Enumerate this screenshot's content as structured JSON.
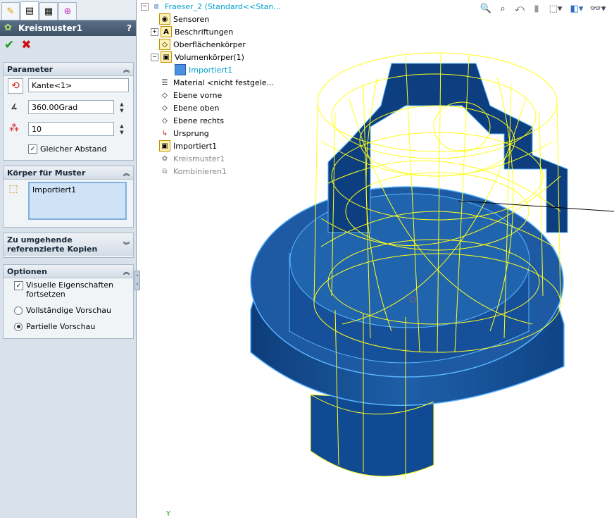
{
  "pm": {
    "tabs": [
      {
        "icon": "feature-manager-icon",
        "active": false
      },
      {
        "icon": "property-manager-icon",
        "active": true
      },
      {
        "icon": "configuration-manager-icon",
        "active": false
      },
      {
        "icon": "dimxpert-icon",
        "active": false
      }
    ],
    "title": "Kreismuster1",
    "help": "?",
    "parameter": {
      "header": "Parameter",
      "edge_value": "Kante<1>",
      "angle_value": "360.00Grad",
      "count_value": "10",
      "equal_spacing_label": "Gleicher Abstand"
    },
    "bodies": {
      "header": "Körper für Muster",
      "item": "Importiert1"
    },
    "skip": {
      "header": "Zu umgehende referenzierte Kopien"
    },
    "options": {
      "header": "Optionen",
      "visual_props": "Visuelle Eigenschaften fortsetzen",
      "full_preview": "Vollständige Vorschau",
      "partial_preview": "Partielle Vorschau"
    }
  },
  "tree": {
    "root": "Fraeser_2  (Standard<<Stan...",
    "items": [
      {
        "label": "Sensoren",
        "icon": "sensor-icon"
      },
      {
        "label": "Beschriftungen",
        "icon": "annotation-icon"
      },
      {
        "label": "Oberflächenkörper",
        "icon": "surface-body-icon"
      },
      {
        "label": "Volumenkörper(1)",
        "icon": "solid-body-icon"
      },
      {
        "label": "Importiert1",
        "icon": "body-icon"
      },
      {
        "label": "Material <nicht festgele...",
        "icon": "material-icon"
      },
      {
        "label": "Ebene vorne",
        "icon": "plane-icon"
      },
      {
        "label": "Ebene oben",
        "icon": "plane-icon"
      },
      {
        "label": "Ebene rechts",
        "icon": "plane-icon"
      },
      {
        "label": "Ursprung",
        "icon": "origin-icon"
      },
      {
        "label": "Importiert1",
        "icon": "imported-feature-icon"
      },
      {
        "label": "Kreismuster1",
        "icon": "circular-pattern-icon"
      },
      {
        "label": "Kombinieren1",
        "icon": "combine-icon"
      }
    ]
  },
  "viewport": {
    "axis_label": "Y"
  },
  "colors": {
    "accent_title": "#3e5268",
    "model_fill": "#1e5fa8",
    "wire": "#ffff1a",
    "edge": "#5ab4ff"
  }
}
